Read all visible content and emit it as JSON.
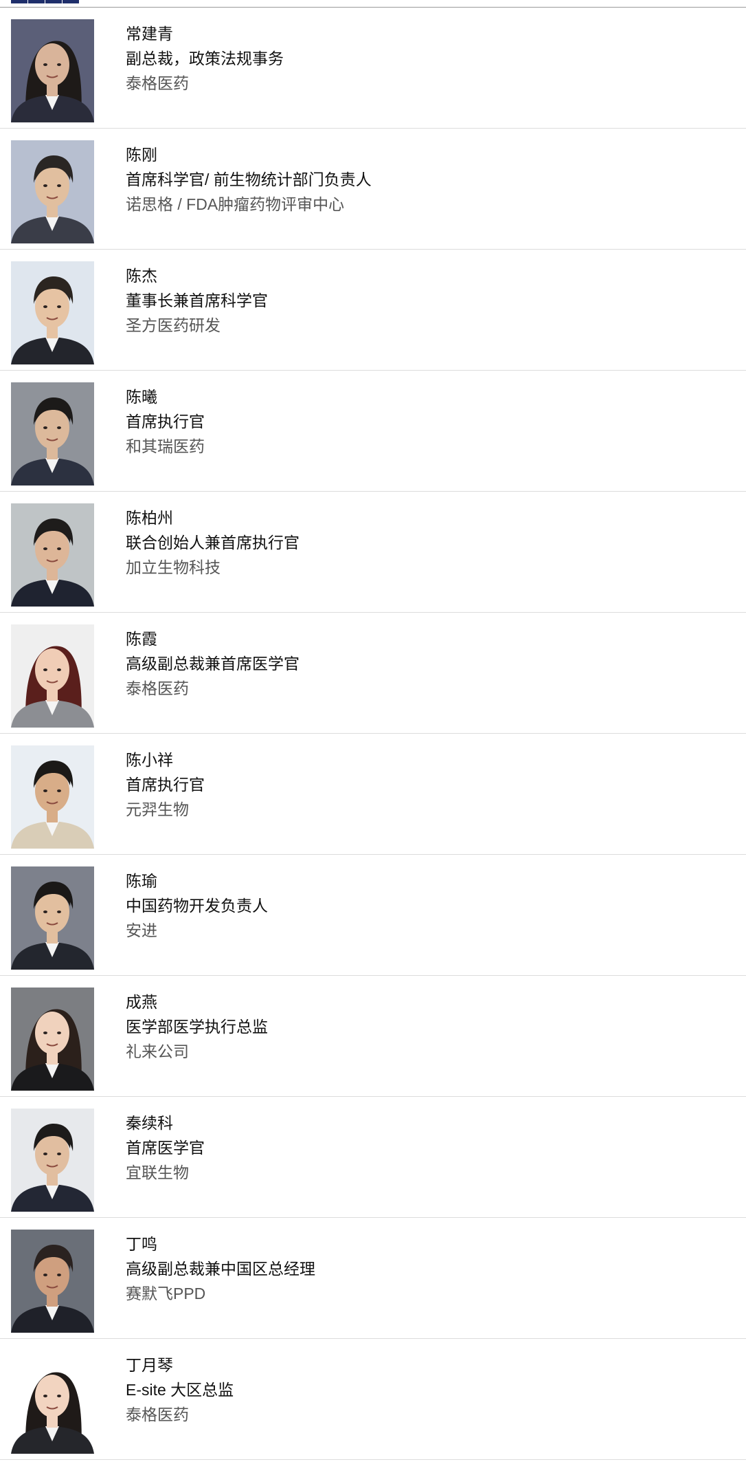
{
  "speakers": [
    {
      "name": "常建青",
      "title": "副总裁，政策法规事务",
      "org": "泰格医药",
      "bg": "#5b5f78",
      "skin": "#d9b49a",
      "hair": "#1e1a18",
      "suit": "#2a2c3a",
      "female": true
    },
    {
      "name": "陈刚",
      "title": "首席科学官/ 前生物统计部门负责人",
      "org": "诺思格 / FDA肿瘤药物评审中心",
      "bg": "#b7bfd0",
      "skin": "#e1bf9f",
      "hair": "#2a2624",
      "suit": "#3a3d48",
      "female": false
    },
    {
      "name": "陈杰",
      "title": "董事长兼首席科学官",
      "org": "圣方医药研发",
      "bg": "#dfe6ee",
      "skin": "#e6c3a3",
      "hair": "#2b2520",
      "suit": "#23252c",
      "female": false
    },
    {
      "name": "陈曦",
      "title": "首席执行官",
      "org": "和其瑞医药",
      "bg": "#8f939a",
      "skin": "#dcb99b",
      "hair": "#1c1a19",
      "suit": "#2c3140",
      "female": false
    },
    {
      "name": "陈柏州",
      "title": "联合创始人兼首席执行官",
      "org": "加立生物科技",
      "bg": "#bfc4c6",
      "skin": "#ddb698",
      "hair": "#1e1c1b",
      "suit": "#1f2330",
      "female": false
    },
    {
      "name": "陈霞",
      "title": "高级副总裁兼首席医学官",
      "org": "泰格医药",
      "bg": "#efefef",
      "skin": "#f0cdb6",
      "hair": "#5a1f1c",
      "suit": "#8c8e93",
      "female": true
    },
    {
      "name": "陈小祥",
      "title": "首席执行官",
      "org": "元羿生物",
      "bg": "#e9eef3",
      "skin": "#d8ad88",
      "hair": "#1b1917",
      "suit": "#d9cdb7",
      "female": false
    },
    {
      "name": "陈瑜",
      "title": "中国药物开发负责人",
      "org": "安进",
      "bg": "#7d818c",
      "skin": "#e2bf9f",
      "hair": "#1a1817",
      "suit": "#23262e",
      "female": false
    },
    {
      "name": "成燕",
      "title": "医学部医学执行总监",
      "org": "礼来公司",
      "bg": "#7c7e82",
      "skin": "#f0d2bd",
      "hair": "#2b201b",
      "suit": "#1a1a1c",
      "female": true
    },
    {
      "name": "秦续科",
      "title": "首席医学官",
      "org": "宜联生物",
      "bg": "#e7e9ec",
      "skin": "#e1bea0",
      "hair": "#1d1b1a",
      "suit": "#232734",
      "female": false
    },
    {
      "name": "丁鸣",
      "title": "高级副总裁兼中国区总经理",
      "org": "赛默飞PPD",
      "bg": "#6a6f78",
      "skin": "#cf9f7f",
      "hair": "#2a2220",
      "suit": "#1f2129",
      "female": false
    },
    {
      "name": "丁月琴",
      "title": "E-site 大区总监",
      "org": "泰格医药",
      "bg": "#ffffff",
      "skin": "#f2d4c0",
      "hair": "#1f1a18",
      "suit": "#25262b",
      "female": true
    }
  ]
}
